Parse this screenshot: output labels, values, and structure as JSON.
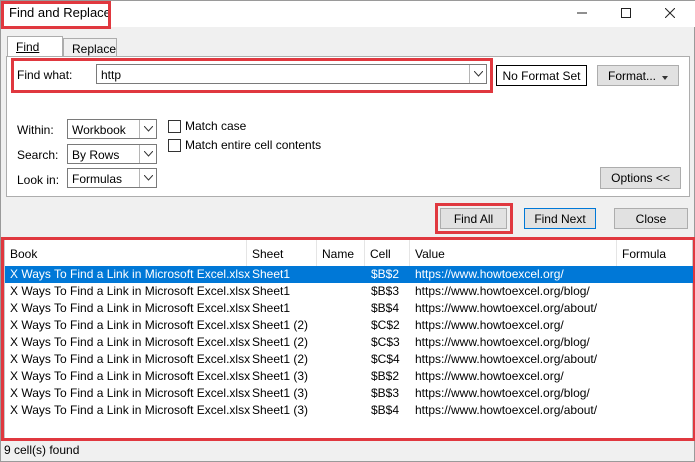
{
  "window": {
    "title": "Find and Replace",
    "minimize_icon": "minimize-icon",
    "maximize_icon": "maximize-icon",
    "close_icon": "close-icon"
  },
  "tabs": [
    {
      "label": "Find",
      "active": true
    },
    {
      "label": "Replace",
      "active": false
    }
  ],
  "find": {
    "label": "Find what:",
    "value": "http",
    "format_status": "No Format Set",
    "format_button": "Format..."
  },
  "options": {
    "within_label": "Within:",
    "within_value": "Workbook",
    "search_label": "Search:",
    "search_value": "By Rows",
    "lookin_label": "Look in:",
    "lookin_value": "Formulas",
    "match_case": "Match case",
    "match_entire": "Match entire cell contents",
    "options_button": "Options <<"
  },
  "buttons": {
    "find_all": "Find All",
    "find_next": "Find Next",
    "close": "Close"
  },
  "results": {
    "columns": [
      "Book",
      "Sheet",
      "Name",
      "Cell",
      "Value",
      "Formula"
    ],
    "rows": [
      {
        "book": "X Ways To Find a Link in Microsoft Excel.xlsx",
        "sheet": "Sheet1",
        "name": "",
        "cell": "$B$2",
        "value": "https://www.howtoexcel.org/",
        "formula": "",
        "selected": true
      },
      {
        "book": "X Ways To Find a Link in Microsoft Excel.xlsx",
        "sheet": "Sheet1",
        "name": "",
        "cell": "$B$3",
        "value": "https://www.howtoexcel.org/blog/",
        "formula": ""
      },
      {
        "book": "X Ways To Find a Link in Microsoft Excel.xlsx",
        "sheet": "Sheet1",
        "name": "",
        "cell": "$B$4",
        "value": "https://www.howtoexcel.org/about/",
        "formula": ""
      },
      {
        "book": "X Ways To Find a Link in Microsoft Excel.xlsx",
        "sheet": "Sheet1 (2)",
        "name": "",
        "cell": "$C$2",
        "value": "https://www.howtoexcel.org/",
        "formula": ""
      },
      {
        "book": "X Ways To Find a Link in Microsoft Excel.xlsx",
        "sheet": "Sheet1 (2)",
        "name": "",
        "cell": "$C$3",
        "value": "https://www.howtoexcel.org/blog/",
        "formula": ""
      },
      {
        "book": "X Ways To Find a Link in Microsoft Excel.xlsx",
        "sheet": "Sheet1 (2)",
        "name": "",
        "cell": "$C$4",
        "value": "https://www.howtoexcel.org/about/",
        "formula": ""
      },
      {
        "book": "X Ways To Find a Link in Microsoft Excel.xlsx",
        "sheet": "Sheet1 (3)",
        "name": "",
        "cell": "$B$2",
        "value": "https://www.howtoexcel.org/",
        "formula": ""
      },
      {
        "book": "X Ways To Find a Link in Microsoft Excel.xlsx",
        "sheet": "Sheet1 (3)",
        "name": "",
        "cell": "$B$3",
        "value": "https://www.howtoexcel.org/blog/",
        "formula": ""
      },
      {
        "book": "X Ways To Find a Link in Microsoft Excel.xlsx",
        "sheet": "Sheet1 (3)",
        "name": "",
        "cell": "$B$4",
        "value": "https://www.howtoexcel.org/about/",
        "formula": ""
      }
    ]
  },
  "status": "9 cell(s) found",
  "colors": {
    "highlight_box": "#e0383f",
    "selection": "#0078d7"
  }
}
